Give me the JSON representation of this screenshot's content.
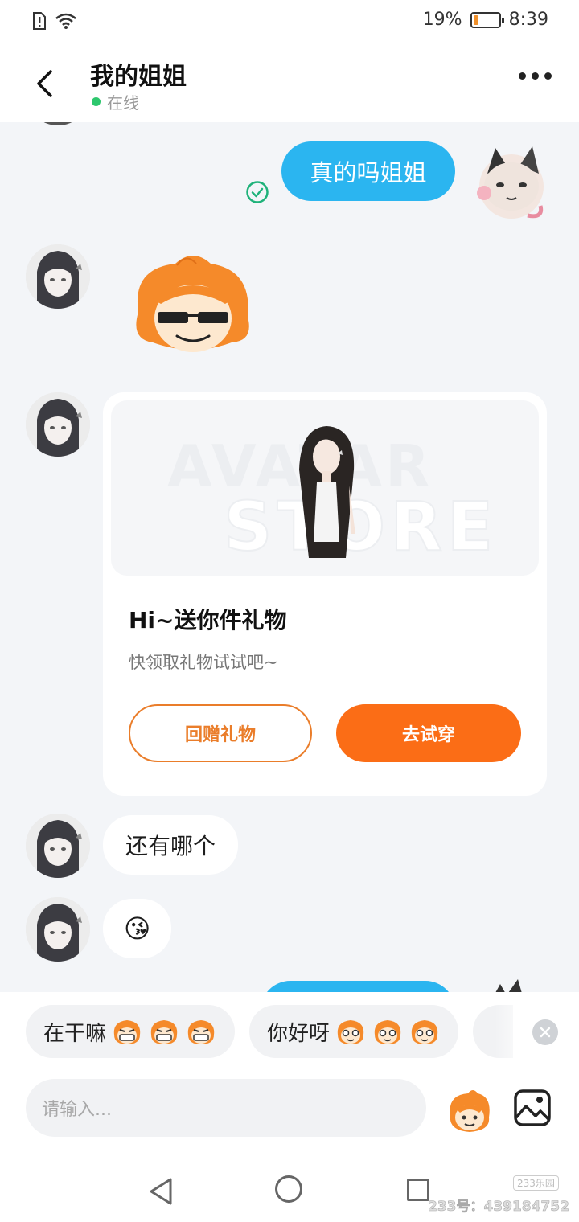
{
  "status_bar": {
    "battery": "19%",
    "battery_level": 0.19,
    "time": "8:39"
  },
  "header": {
    "title": "我的姐姐",
    "status": "在线"
  },
  "messages": {
    "me_1": "真的吗姐姐",
    "them_text_1": "还有哪个",
    "them_emoji_1": "😘"
  },
  "gift_card": {
    "watermark_1": "AVATAR",
    "watermark_2": "STORE",
    "title": "Hi~送你件礼物",
    "subtitle": "快领取礼物试试吧~",
    "return_button": "回赠礼物",
    "try_button": "去试穿"
  },
  "quick_replies": [
    {
      "text": "在干嘛"
    },
    {
      "text": "你好呀"
    }
  ],
  "input": {
    "placeholder": "请输入..."
  },
  "watermark": {
    "badge": "233乐园",
    "id": "233号：439184752"
  },
  "colors": {
    "accent_blue": "#2bb5f0",
    "accent_orange": "#fb6d16",
    "online_green": "#2dc76d"
  },
  "icons": [
    "back-arrow-icon",
    "more-icon",
    "sent-check-icon",
    "emoji-icon",
    "image-icon",
    "close-icon"
  ]
}
